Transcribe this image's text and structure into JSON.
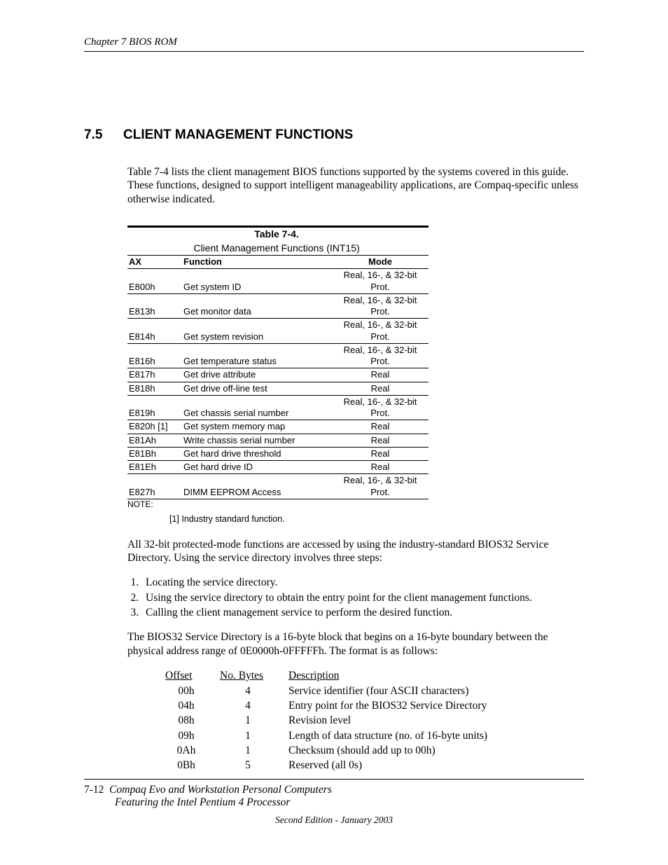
{
  "header": {
    "chapter": "Chapter 7  BIOS ROM"
  },
  "section": {
    "number": "7.5",
    "title": "CLIENT MANAGEMENT FUNCTIONS"
  },
  "intro": "Table 7-4 lists the client management BIOS functions supported by the systems covered in this guide. These functions, designed to support intelligent manageability applications, are Compaq-specific unless otherwise indicated.",
  "table74": {
    "caption": "Table 7-4.",
    "subtitle": "Client Management Functions (INT15)",
    "headers": {
      "ax": "AX",
      "fn": "Function",
      "mode": "Mode"
    },
    "rows": [
      {
        "ax": "E800h",
        "fn": "Get system ID",
        "mode": "Real, 16-, & 32-bit Prot."
      },
      {
        "ax": "E813h",
        "fn": "Get monitor data",
        "mode": "Real, 16-, & 32-bit Prot."
      },
      {
        "ax": "E814h",
        "fn": "Get system revision",
        "mode": "Real, 16-, & 32-bit Prot."
      },
      {
        "ax": "E816h",
        "fn": "Get temperature status",
        "mode": "Real, 16-, & 32-bit Prot."
      },
      {
        "ax": "E817h",
        "fn": "Get drive attribute",
        "mode": "Real"
      },
      {
        "ax": "E818h",
        "fn": "Get drive off-line test",
        "mode": "Real"
      },
      {
        "ax": "E819h",
        "fn": "Get chassis serial number",
        "mode": "Real, 16-, & 32-bit Prot."
      },
      {
        "ax": "E820h [1]",
        "fn": "Get system memory map",
        "mode": "Real"
      },
      {
        "ax": "E81Ah",
        "fn": "Write chassis serial number",
        "mode": "Real"
      },
      {
        "ax": "E81Bh",
        "fn": "Get hard drive threshold",
        "mode": "Real"
      },
      {
        "ax": "E81Eh",
        "fn": "Get hard drive ID",
        "mode": "Real"
      },
      {
        "ax": "E827h",
        "fn": "DIMM EEPROM Access",
        "mode": "Real, 16-, & 32-bit Prot."
      }
    ],
    "note_label": "NOTE:",
    "note_text": "[1] Industry standard function."
  },
  "para2": "All 32-bit protected-mode functions are accessed by using the industry-standard BIOS32 Service Directory.  Using the service directory involves three steps:",
  "steps": [
    "Locating the service directory.",
    "Using the service directory to obtain the entry point for the client management functions.",
    "Calling the client management service to perform the desired function."
  ],
  "para3": "The BIOS32 Service Directory is a 16-byte block that begins on a 16-byte boundary between the physical address range of 0E0000h-0FFFFFh. The format is as follows:",
  "fmt": {
    "headers": {
      "offset": "Offset",
      "nbytes": "No. Bytes",
      "desc": "Description"
    },
    "rows": [
      {
        "offset": "00h",
        "nbytes": "4",
        "desc": "Service identifier (four ASCII characters)"
      },
      {
        "offset": "04h",
        "nbytes": "4",
        "desc": "Entry point for the BIOS32 Service Directory"
      },
      {
        "offset": "08h",
        "nbytes": "1",
        "desc": "Revision level"
      },
      {
        "offset": "09h",
        "nbytes": "1",
        "desc": "Length of data structure (no. of 16-byte units)"
      },
      {
        "offset": "0Ah",
        "nbytes": "1",
        "desc": "Checksum (should add up to 00h)"
      },
      {
        "offset": "0Bh",
        "nbytes": "5",
        "desc": "Reserved (all 0s)"
      }
    ]
  },
  "footer": {
    "pagenum": "7-12",
    "title1": "Compaq Evo and Workstation Personal Computers",
    "title2": "Featuring the Intel Pentium 4 Processor",
    "edition": "Second Edition -  January 2003"
  }
}
